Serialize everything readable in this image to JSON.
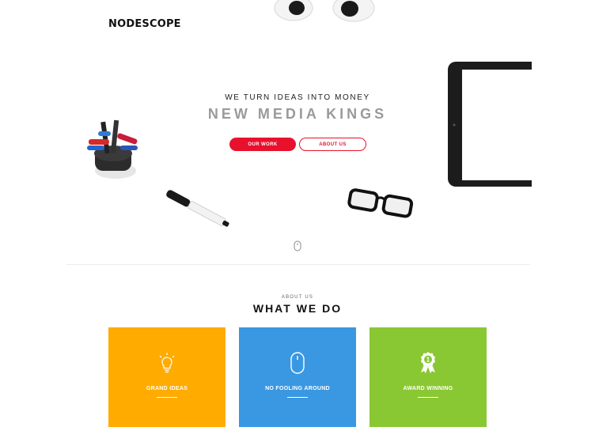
{
  "brand": {
    "logo": "NODESCOPE"
  },
  "hero": {
    "kicker": "WE TURN IDEAS INTO MONEY",
    "title": "NEW MEDIA KINGS",
    "primary_button": "OUR WORK",
    "secondary_button": "ABOUT US"
  },
  "about": {
    "kicker": "ABOUT US",
    "title": "WHAT WE DO",
    "cards": [
      {
        "label": "GRAND IDEAS",
        "icon": "lightbulb-icon",
        "color": "#ffab00"
      },
      {
        "label": "NO FOOLING AROUND",
        "icon": "mouse-icon",
        "color": "#3a98e2"
      },
      {
        "label": "AWARD WINNING",
        "icon": "award-ribbon-icon",
        "color": "#8ac833"
      }
    ]
  },
  "colors": {
    "accent": "#e8112d",
    "hero_title": "#9a9a9a"
  }
}
